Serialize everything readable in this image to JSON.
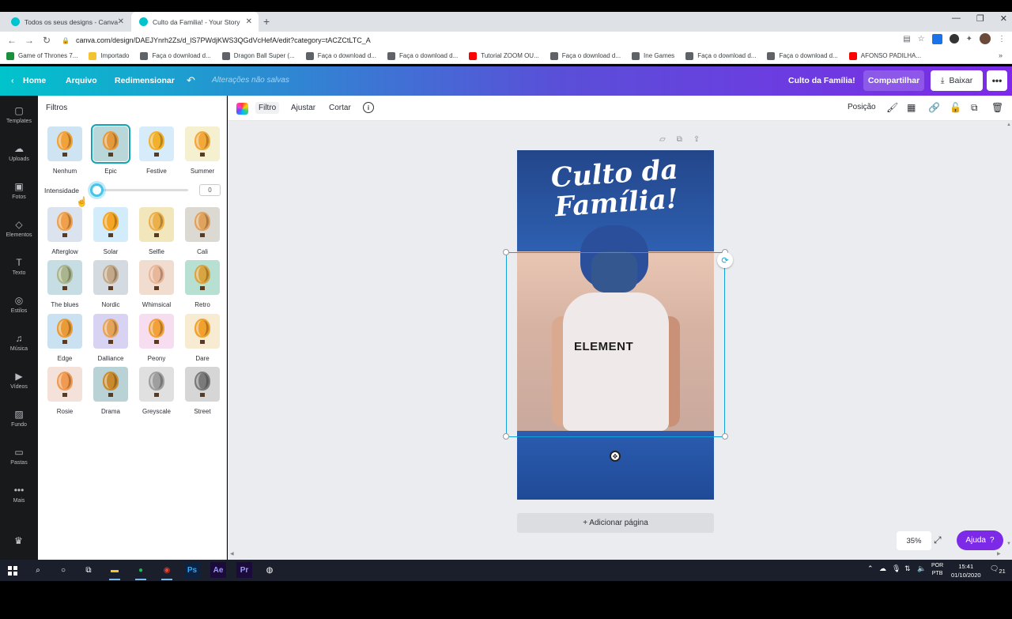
{
  "browser": {
    "tabs": [
      {
        "title": "Todos os seus designs - Canva",
        "active": false
      },
      {
        "title": "Culto da Familia! - Your Story",
        "active": true
      }
    ],
    "url": "canva.com/design/DAEJYnrh2Zs/d_lS7PWdjKWS3QGdVcHefA/edit?category=tACZCtLTC_A",
    "bookmarks": [
      {
        "label": "Game of Thrones 7...",
        "color": "#1a8f3c"
      },
      {
        "label": "Importado",
        "color": "#f4c430"
      },
      {
        "label": "Faça o download d...",
        "color": "#5f6368"
      },
      {
        "label": "Dragon Ball Super (...",
        "color": "#5f6368"
      },
      {
        "label": "Faça o download d...",
        "color": "#5f6368"
      },
      {
        "label": "Faça o download d...",
        "color": "#5f6368"
      },
      {
        "label": "Tutorial ZOOM OU...",
        "color": "#ff0000"
      },
      {
        "label": "Faça o download d...",
        "color": "#5f6368"
      },
      {
        "label": "Ine Games",
        "color": "#5f6368"
      },
      {
        "label": "Faça o download d...",
        "color": "#5f6368"
      },
      {
        "label": "Faça o download d...",
        "color": "#5f6368"
      },
      {
        "label": "AFONSO PADILHA...",
        "color": "#ff0000"
      }
    ],
    "bookmarks_more": "»"
  },
  "header": {
    "home": "Home",
    "file": "Arquivo",
    "resize": "Redimensionar",
    "unsaved": "Alterações não salvas",
    "title": "Culto da Família!",
    "share": "Compartilhar",
    "download": "Baixar"
  },
  "rail": [
    {
      "label": "Templates",
      "icon": "templates-icon",
      "glyph": "▢"
    },
    {
      "label": "Uploads",
      "icon": "upload-icon",
      "glyph": "☁"
    },
    {
      "label": "Fotos",
      "icon": "photos-icon",
      "glyph": "▣"
    },
    {
      "label": "Elementos",
      "icon": "elements-icon",
      "glyph": "◇"
    },
    {
      "label": "Texto",
      "icon": "text-icon",
      "glyph": "T"
    },
    {
      "label": "Estilos",
      "icon": "styles-icon",
      "glyph": "◎"
    },
    {
      "label": "Música",
      "icon": "music-icon",
      "glyph": "♫"
    },
    {
      "label": "Vídeos",
      "icon": "videos-icon",
      "glyph": "▶"
    },
    {
      "label": "Fundo",
      "icon": "background-icon",
      "glyph": "▨"
    },
    {
      "label": "Pastas",
      "icon": "folders-icon",
      "glyph": "▭"
    },
    {
      "label": "Mais",
      "icon": "more-icon",
      "glyph": "•••"
    }
  ],
  "filters": {
    "panel_title": "Filtros",
    "intensity_label": "Intensidade",
    "intensity_value": "0",
    "intensity_level": 0,
    "selected": "Epic",
    "items": [
      {
        "label": "Nenhum",
        "sky": "#cfe4f2",
        "balloon": "#f1a23a"
      },
      {
        "label": "Epic",
        "sky": "#b9d6d8",
        "balloon": "#e49a3c"
      },
      {
        "label": "Festive",
        "sky": "#d6ecfa",
        "balloon": "#f2b12c"
      },
      {
        "label": "Summer",
        "sky": "#f4f0d0",
        "balloon": "#f3a93a"
      },
      {
        "label": "Afterglow",
        "sky": "#dbe4ee",
        "balloon": "#f0a04a"
      },
      {
        "label": "Solar",
        "sky": "#d3ecfb",
        "balloon": "#f5a525"
      },
      {
        "label": "Selfie",
        "sky": "#f2e6bd",
        "balloon": "#ecb04a"
      },
      {
        "label": "Cali",
        "sky": "#dbd9d2",
        "balloon": "#e0a35e"
      },
      {
        "label": "The blues",
        "sky": "#c7dde4",
        "balloon": "#a9b58c"
      },
      {
        "label": "Nordic",
        "sky": "#d4dbe0",
        "balloon": "#c3a98a"
      },
      {
        "label": "Whimsical",
        "sky": "#f1ddd0",
        "balloon": "#e8b79a"
      },
      {
        "label": "Retro",
        "sky": "#b7e0d2",
        "balloon": "#d9a540"
      },
      {
        "label": "Edge",
        "sky": "#c9e1f0",
        "balloon": "#e99b38"
      },
      {
        "label": "Dalliance",
        "sky": "#d8d3f2",
        "balloon": "#e6a35a"
      },
      {
        "label": "Peony",
        "sky": "#f6def0",
        "balloon": "#f2a03a"
      },
      {
        "label": "Dare",
        "sky": "#f7ecd2",
        "balloon": "#f0a12e"
      },
      {
        "label": "Rosie",
        "sky": "#f4e2da",
        "balloon": "#f09a52"
      },
      {
        "label": "Drama",
        "sky": "#b8d2d6",
        "balloon": "#c98a2e"
      },
      {
        "label": "Greyscale",
        "sky": "#e0e0e0",
        "balloon": "#9e9e9e"
      },
      {
        "label": "Street",
        "sky": "#d6d6d6",
        "balloon": "#7a7a7a"
      }
    ]
  },
  "toolbar": {
    "filter": "Filtro",
    "adjust": "Ajustar",
    "crop": "Cortar",
    "info": "i",
    "position": "Posição"
  },
  "canvas": {
    "design_title_line1": "Culto da",
    "design_title_line2": "Família!",
    "shirt_text": "ELEMENT",
    "add_page": "+ Adicionar página",
    "zoom": "35%",
    "help": "Ajuda",
    "help_icon": "?"
  },
  "taskbar": {
    "lang_line1": "POR",
    "lang_line2": "PTB",
    "time": "15:41",
    "date": "01/10/2020",
    "notifications": "21",
    "apps": [
      "Ps",
      "Ae",
      "Pr"
    ]
  }
}
